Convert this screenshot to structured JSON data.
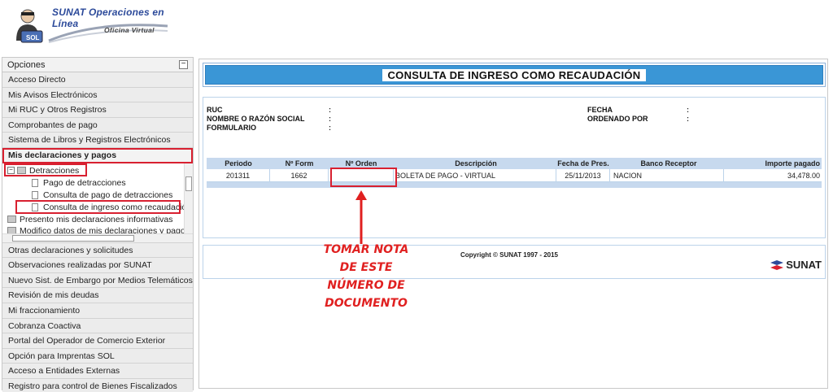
{
  "header": {
    "logo_title": "SUNAT Operaciones en Línea",
    "logo_subtitle": "Oficina Virtual",
    "logo_badge": "SOL"
  },
  "sidebar": {
    "heading": "Opciones",
    "collapse_symbol": "−",
    "items_top": [
      "Acceso Directo",
      "Mis Avisos Electrónicos",
      "Mi RUC y Otros Registros",
      "Comprobantes de pago",
      "Sistema de Libros y Registros Electrónicos",
      "Mis declaraciones y pagos"
    ],
    "tree": {
      "folder": "Detracciones",
      "children": [
        "Pago de detracciones",
        "Consulta de pago de detracciones",
        "Consulta de ingreso como recaudación"
      ],
      "siblings": [
        "Presento mis declaraciones informativas",
        "Modifico datos de mis declaraciones y pagos"
      ]
    },
    "items_bottom": [
      "Otras declaraciones y solicitudes",
      "Observaciones realizadas por SUNAT",
      "Nuevo Sist. de Embargo por Medios Telemáticos",
      "Revisión de mis deudas",
      "Mi fraccionamiento",
      "Cobranza Coactiva",
      "Portal del Operador de Comercio Exterior",
      "Opción para Imprentas SOL",
      "Acceso a Entidades Externas",
      "Registro para control de Bienes Fiscalizados"
    ]
  },
  "main": {
    "title": "CONSULTA DE INGRESO COMO RECAUDACIÓN",
    "fields_left": [
      "RUC",
      "NOMBRE O RAZÓN SOCIAL",
      "FORMULARIO"
    ],
    "fields_right": [
      "FECHA",
      "ORDENADO POR"
    ],
    "colon": ":",
    "table": {
      "headers": [
        "Periodo",
        "Nº Form",
        "Nº Orden",
        "Descripción",
        "Fecha de Pres.",
        "Banco Receptor",
        "Importe pagado"
      ],
      "rows": [
        [
          "201311",
          "1662",
          "",
          "BOLETA DE PAGO - VIRTUAL",
          "25/11/2013",
          "NACION",
          "34,478.00"
        ]
      ]
    },
    "copyright": "Copyright © SUNAT 1997 - 2015",
    "footer_logo": "SUNAT"
  },
  "annotation": {
    "lines": [
      "TOMAR NOTA",
      "DE ESTE",
      "NÚMERO DE",
      "DOCUMENTO"
    ],
    "color": "#e02020"
  },
  "colors": {
    "title_bar": "#3a96d6",
    "table_header": "#c7d9ee",
    "highlight": "#d82030"
  }
}
